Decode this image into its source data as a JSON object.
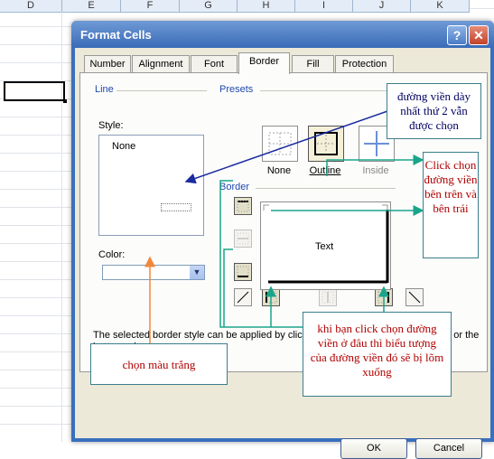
{
  "spreadsheet": {
    "columns": [
      "D",
      "E",
      "F",
      "G",
      "H",
      "I",
      "J",
      "K"
    ]
  },
  "dialog": {
    "title": "Format Cells",
    "help_glyph": "?",
    "close_glyph": "✕",
    "tabs": [
      "Number",
      "Alignment",
      "Font",
      "Border",
      "Fill",
      "Protection"
    ],
    "active_tab": "Border",
    "line_group": {
      "label": "Line",
      "style_label": "Style:",
      "style_selected": "None",
      "color_label": "Color:",
      "color_value": ""
    },
    "presets_group": {
      "label": "Presets",
      "items": [
        "None",
        "Outline",
        "Inside"
      ]
    },
    "border_group": {
      "label": "Border",
      "preview_text": "Text"
    },
    "description": "The selected border style can be applied by clicking the presets, preview diagram or the buttons above.",
    "buttons": {
      "ok": "OK",
      "cancel": "Cancel"
    }
  },
  "annotations": {
    "second_thickest": "đường viền dày nhất thứ 2 vẫn được chọn",
    "click_top_left": "Click chọn đường viền bên trên và bên trái",
    "pressed_icons": "khi bạn click chọn đường viền ở đâu thì biểu tượng của đường viền đó sẽ bị lõm xuống",
    "white_color": "chọn màu trắng"
  },
  "colors": {
    "title_bar": "#3a6bb8",
    "annotation_arrow_green": "#1aa58a",
    "annotation_arrow_orange": "#f0883a",
    "annotation_arrow_blue": "#1a2ca0"
  }
}
